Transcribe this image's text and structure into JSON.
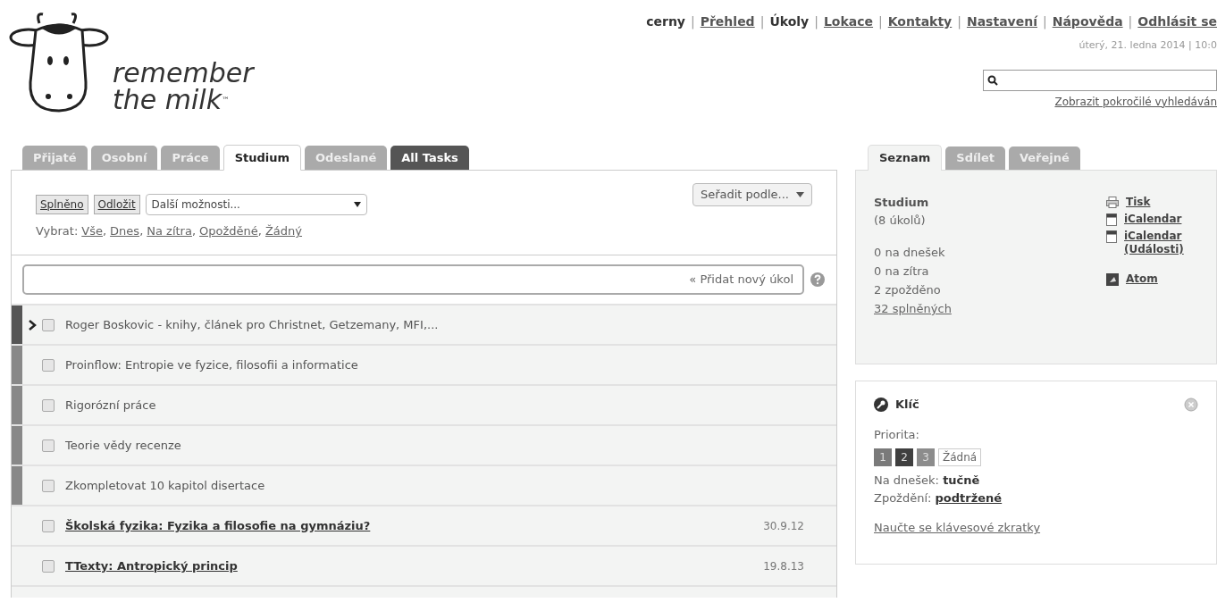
{
  "logo": {
    "line1": "remember",
    "line2": "the milk",
    "mark": "™"
  },
  "top_nav": [
    {
      "label": "cerny",
      "kind": "user"
    },
    {
      "separator": "|",
      "label": "Přehled",
      "kind": "link",
      "selected": false
    },
    {
      "separator": "|",
      "label": "Úkoly",
      "kind": "link",
      "selected": true
    },
    {
      "separator": "|",
      "label": "Lokace",
      "kind": "link",
      "selected": false
    },
    {
      "separator": "|",
      "label": "Kontakty",
      "kind": "link",
      "selected": false
    },
    {
      "separator": "|",
      "label": "Nastavení",
      "kind": "link",
      "selected": false
    },
    {
      "separator": "|",
      "label": "Nápověda",
      "kind": "link",
      "selected": false
    },
    {
      "separator": "|",
      "label": "Odhlásit se",
      "kind": "link",
      "selected": false
    }
  ],
  "datetime": "úterý, 21. ledna 2014 | 10:0",
  "advanced_search": "Zobrazit pokročilé vyhledáván",
  "list_tabs": [
    {
      "label": "Přijaté",
      "kind": "list",
      "selected": false
    },
    {
      "label": "Osobní",
      "kind": "list",
      "selected": false
    },
    {
      "label": "Práce",
      "kind": "list",
      "selected": false
    },
    {
      "label": "Studium",
      "kind": "list",
      "selected": true
    },
    {
      "label": "Odeslané",
      "kind": "list",
      "selected": false
    },
    {
      "label": "All Tasks",
      "kind": "smart",
      "selected": false
    }
  ],
  "toolbar": {
    "buttons": [
      "Splněno",
      "Odložit"
    ],
    "more_select": "Další možnosti...",
    "sort": "Seřadit podle...",
    "select_label": "Vybrat:",
    "select_links": [
      {
        "label": "Vše",
        "separator": ","
      },
      {
        "label": "Dnes",
        "separator": ","
      },
      {
        "label": "Na zítra",
        "separator": ","
      },
      {
        "label": "Opožděné",
        "separator": ","
      },
      {
        "label": "Žádný"
      }
    ]
  },
  "add_task": {
    "placeholder": "« Přidat nový úkol"
  },
  "tasks": [
    {
      "name": "Roger Boskovic - knihy, článek pro Christnet, Getzemany, MFI,...",
      "color": "#555555",
      "selected": true,
      "checked": false,
      "overdue": false
    },
    {
      "name": "Proinflow: Entropie ve fyzice, filosofii a informatice",
      "color": "#888888",
      "selected": false,
      "checked": false,
      "overdue": false
    },
    {
      "name": "Rigorózní práce",
      "color": "#888888",
      "selected": false,
      "checked": false,
      "overdue": false
    },
    {
      "name": "Teorie vědy recenze",
      "color": "#888888",
      "selected": false,
      "checked": false,
      "overdue": false
    },
    {
      "name": "Zkompletovat 10 kapitol disertace",
      "color": "#888888",
      "selected": false,
      "checked": false,
      "overdue": false
    },
    {
      "name": "Školská fyzika: Fyzika a filosofie na gymnáziu?",
      "selected": false,
      "checked": false,
      "overdue": true,
      "date": "30.9.12"
    },
    {
      "name": "TTexty: Antropický princip",
      "selected": false,
      "checked": false,
      "overdue": true,
      "date": "19.8.13"
    }
  ],
  "info_tabs": [
    {
      "label": "Seznam",
      "selected": true
    },
    {
      "label": "Sdílet",
      "selected": false
    },
    {
      "label": "Veřejné",
      "selected": false
    }
  ],
  "info": {
    "title": "Studium",
    "count": "(8 úkolů)",
    "stats": [
      {
        "text": "0 na dnešek",
        "link": false
      },
      {
        "text": "0 na zítra",
        "link": false
      },
      {
        "text": "2 zpožděno",
        "link": false
      },
      {
        "text": "32 splněných",
        "link": true
      }
    ],
    "links": [
      {
        "label": "Tisk",
        "kind": "print"
      },
      {
        "label": "iCalendar",
        "kind": "calendar"
      },
      {
        "label": "iCalendar (Události)",
        "kind": "calendar"
      },
      {
        "label": "Atom",
        "kind": "feed"
      }
    ]
  },
  "legend": {
    "title": "Klíč",
    "priority_label": "Priorita:",
    "priorities": [
      {
        "label": "1",
        "color": "#7a7a7a"
      },
      {
        "label": "2",
        "color": "#3f3f3f"
      },
      {
        "label": "3",
        "color": "#8c8c8c"
      },
      {
        "label": "Žádná"
      }
    ],
    "today": "Na dnešek: **tučně**",
    "overdue": "Zpoždění: **podtržené**",
    "shortcuts": "Naučte se klávesové zkratky"
  }
}
